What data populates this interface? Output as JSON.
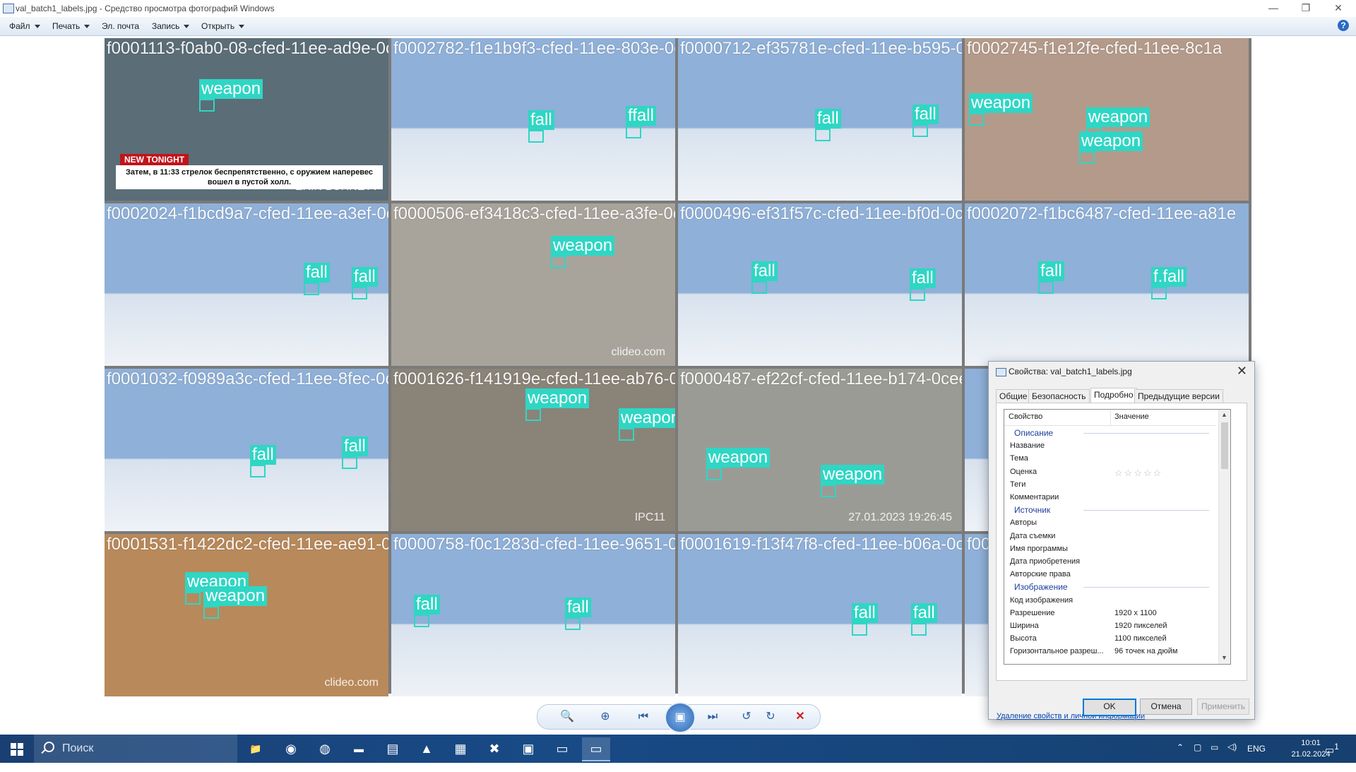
{
  "window": {
    "title": "val_batch1_labels.jpg - Средство просмотра фотографий Windows",
    "min": "—",
    "restore": "❐",
    "close": "✕"
  },
  "menu": [
    "Файл",
    "Печать",
    "Эл. почта",
    "Запись",
    "Открыть"
  ],
  "help": "?",
  "mosaic": {
    "tiles": [
      {
        "fname": "f0001113-f0ab0-08-cfed-11ee-ad9e-0cee7c",
        "bg": "#5b6d77",
        "dets": [
          {
            "label": "weapon"
          }
        ],
        "overlay": "NEW TONIGHT",
        "caption": "Затем, в 11:33 стрелок беспрепятственно, с оружием наперевес вошел в пустой холл.",
        "credit": "ERIN BURNETT"
      },
      {
        "fname": "f0002782-f1e1b9f3-cfed-11ee-803e-0cee7c",
        "bg": "#8fb0d8",
        "dets": [
          {
            "label": "fall"
          },
          {
            "label": "ffall"
          }
        ]
      },
      {
        "fname": "f0000712-ef35781e-cfed-11ee-b595-0cee7c",
        "bg": "#8fb0d8",
        "dets": [
          {
            "label": "fall"
          },
          {
            "label": "fall"
          }
        ]
      },
      {
        "fname": "f0002745-f1e12fe-cfed-11ee-8c1a",
        "bg": "#b49a8a",
        "dets": [
          {
            "label": "weapon"
          },
          {
            "label": "weapon"
          },
          {
            "label": "weapon"
          }
        ]
      },
      {
        "fname": "f0002024-f1bcd9a7-cfed-11ee-a3ef-0cee7c",
        "bg": "#8fb0d8",
        "dets": [
          {
            "label": "fall"
          },
          {
            "label": "fall"
          }
        ]
      },
      {
        "fname": "f0000506-ef3418c3-cfed-11ee-a3fe-0cee7c",
        "bg": "#a8a49c",
        "dets": [
          {
            "label": "weapon"
          }
        ],
        "credit": "clideo.com"
      },
      {
        "fname": "f0000496-ef31f57c-cfed-11ee-bf0d-0cee7c",
        "bg": "#8fb0d8",
        "dets": [
          {
            "label": "fall"
          },
          {
            "label": "fall"
          }
        ]
      },
      {
        "fname": "f0002072-f1bc6487-cfed-11ee-a81e",
        "bg": "#8fb0d8",
        "dets": [
          {
            "label": "fall"
          },
          {
            "label": "f.fall"
          }
        ]
      },
      {
        "fname": "f0001032-f0989a3c-cfed-11ee-8fec-0cee7c",
        "bg": "#8fb0d8",
        "dets": [
          {
            "label": "fall"
          },
          {
            "label": "fall"
          }
        ]
      },
      {
        "fname": "f0001626-f141919e-cfed-11ee-ab76-0cee7c",
        "bg": "#8a8378",
        "dets": [
          {
            "label": "weapon"
          },
          {
            "label": "weapon"
          }
        ],
        "credit": "IPC11"
      },
      {
        "fname": "f0000487-ef22cf-cfed-11ee-b174-0cee7c",
        "bg": "#9b9b96",
        "dets": [
          {
            "label": "weapon"
          },
          {
            "label": "weapon"
          }
        ],
        "credit": "27.01.2023 19:26:45"
      },
      {
        "fname": "",
        "bg": "#8fb0d8",
        "dets": []
      },
      {
        "fname": "f0001531-f1422dc2-cfed-11ee-ae91-0cee7c",
        "bg": "#b8895a",
        "dets": [
          {
            "label": "weapon"
          },
          {
            "label": "weapon"
          }
        ],
        "credit": "clideo.com"
      },
      {
        "fname": "f0000758-f0c1283d-cfed-11ee-9651-0cee7c",
        "bg": "#8fb0d8",
        "dets": [
          {
            "label": "fall"
          },
          {
            "label": "fall"
          }
        ]
      },
      {
        "fname": "f0001619-f13f47f8-cfed-11ee-b06a-0cee7c",
        "bg": "#8fb0d8",
        "dets": [
          {
            "label": "fall"
          },
          {
            "label": "fall"
          }
        ]
      },
      {
        "fname": "f00",
        "bg": "#8fb0d8",
        "dets": []
      }
    ]
  },
  "viewer_toolbar": {
    "zoom": "🔍",
    "actual_size": "⊕",
    "prev": "⏮",
    "slideshow": "▣",
    "next": "⏭",
    "rotate_left": "↺",
    "rotate_right": "↻",
    "delete": "✕"
  },
  "dialog": {
    "title": "Свойства: val_batch1_labels.jpg",
    "close": "✕",
    "tabs": [
      "Общие",
      "Безопасность",
      "Подробно",
      "Предыдущие версии"
    ],
    "active_tab": "Подробно",
    "col_property": "Свойство",
    "col_value": "Значение",
    "rows": [
      {
        "key": "Описание",
        "value": "",
        "group": true
      },
      {
        "key": "Название",
        "value": ""
      },
      {
        "key": "Тема",
        "value": ""
      },
      {
        "key": "Оценка",
        "value": "☆☆☆☆☆",
        "stars": true
      },
      {
        "key": "Теги",
        "value": ""
      },
      {
        "key": "Комментарии",
        "value": ""
      },
      {
        "key": "Источник",
        "value": "",
        "group": true
      },
      {
        "key": "Авторы",
        "value": ""
      },
      {
        "key": "Дата съемки",
        "value": ""
      },
      {
        "key": "Имя программы",
        "value": ""
      },
      {
        "key": "Дата приобретения",
        "value": ""
      },
      {
        "key": "Авторские права",
        "value": ""
      },
      {
        "key": "Изображение",
        "value": "",
        "group": true
      },
      {
        "key": "Код изображения",
        "value": ""
      },
      {
        "key": "Разрешение",
        "value": "1920 x 1100"
      },
      {
        "key": "Ширина",
        "value": "1920 пикселей"
      },
      {
        "key": "Высота",
        "value": "1100 пикселей"
      },
      {
        "key": "Горизонтальное разреш...",
        "value": "96 точек на дюйм"
      }
    ],
    "link": "Удаление свойств и личной информации",
    "ok": "OK",
    "cancel": "Отмена",
    "apply": "Применить"
  },
  "taskbar": {
    "search_placeholder": "Поиск",
    "lang": "ENG",
    "time": "10:01",
    "date": "21.02.2024",
    "notifications": "1"
  }
}
